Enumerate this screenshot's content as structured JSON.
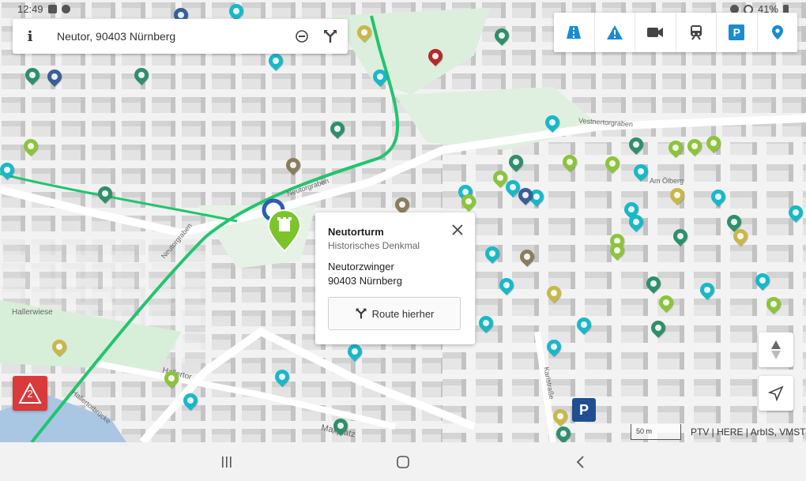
{
  "status_bar": {
    "time": "12:49",
    "battery": "41%"
  },
  "search": {
    "info_label": "i",
    "value": "Neutor, 90403 Nürnberg",
    "icons": [
      "info-icon",
      "minus-circle-icon",
      "route-icon"
    ]
  },
  "layers": {
    "items": [
      {
        "name": "traffic-road-layer",
        "icon": "road-icon"
      },
      {
        "name": "warning-layer",
        "icon": "warning-triangle-icon"
      },
      {
        "name": "camera-layer",
        "icon": "video-camera-icon"
      },
      {
        "name": "transit-layer",
        "icon": "train-icon"
      },
      {
        "name": "parking-layer",
        "icon": "parking-icon",
        "label": "P"
      },
      {
        "name": "poi-layer",
        "icon": "location-pin-icon"
      }
    ],
    "accent": "#1a8ccf"
  },
  "map": {
    "street_labels": [
      "Neutorgraben",
      "Vestnertorgraben",
      "Am Ölberg",
      "Hallertor",
      "Hallerwiese",
      "Hallertorbrücke",
      "Maxplatz",
      "Karlstraße",
      "Neutorgraben"
    ],
    "route_color": "#22c46e"
  },
  "popup": {
    "title": "Neutorturm",
    "subtitle": "Historisches Denkmal",
    "address_line1": "Neutorzwinger",
    "address_line2": "90403 Nürnberg",
    "route_button": "Route hierher"
  },
  "warning": {
    "count": "2",
    "color": "#d93a3a"
  },
  "scale": {
    "label": "50 m"
  },
  "attribution": "PTV | HERE | ArbIS, VMST",
  "nav": {
    "icons": [
      "recent-apps-icon",
      "home-icon",
      "back-icon"
    ]
  }
}
